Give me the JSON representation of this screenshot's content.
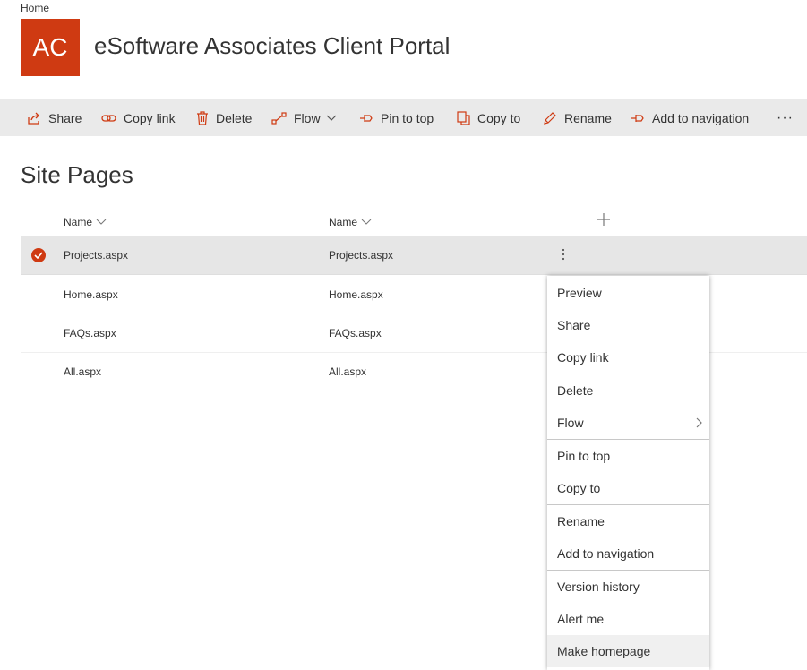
{
  "breadcrumb": "Home",
  "site": {
    "logo_text": "AC",
    "title": "eSoftware Associates Client Portal"
  },
  "commands": {
    "share": "Share",
    "copy_link": "Copy link",
    "delete": "Delete",
    "flow": "Flow",
    "pin_to_top": "Pin to top",
    "copy_to": "Copy to",
    "rename": "Rename",
    "add_to_navigation": "Add to navigation",
    "more": "···"
  },
  "page_heading": "Site Pages",
  "columns": [
    "Name",
    "Name"
  ],
  "rows": [
    {
      "col1": "Projects.aspx",
      "col2": "Projects.aspx",
      "selected": true
    },
    {
      "col1": "Home.aspx",
      "col2": "Home.aspx",
      "selected": false
    },
    {
      "col1": "FAQs.aspx",
      "col2": "FAQs.aspx",
      "selected": false
    },
    {
      "col1": "All.aspx",
      "col2": "All.aspx",
      "selected": false
    }
  ],
  "context_menu": {
    "items": [
      "Preview",
      "Share",
      "Copy link",
      "Delete",
      "Flow",
      "Pin to top",
      "Copy to",
      "Rename",
      "Add to navigation",
      "Version history",
      "Alert me",
      "Make homepage"
    ],
    "highlighted": "Make homepage"
  },
  "colors": {
    "accent": "#cf3a12",
    "commandbar_bg": "#eaeaea",
    "selected_row_bg": "#e6e6e6"
  },
  "icons": [
    "share-icon",
    "link-icon",
    "trash-icon",
    "flow-icon",
    "pin-icon",
    "copy-icon",
    "pencil-icon",
    "navigation-icon",
    "chevron-down-icon",
    "checkmark-icon",
    "plus-icon",
    "more-vertical-icon",
    "chevron-right-icon"
  ]
}
